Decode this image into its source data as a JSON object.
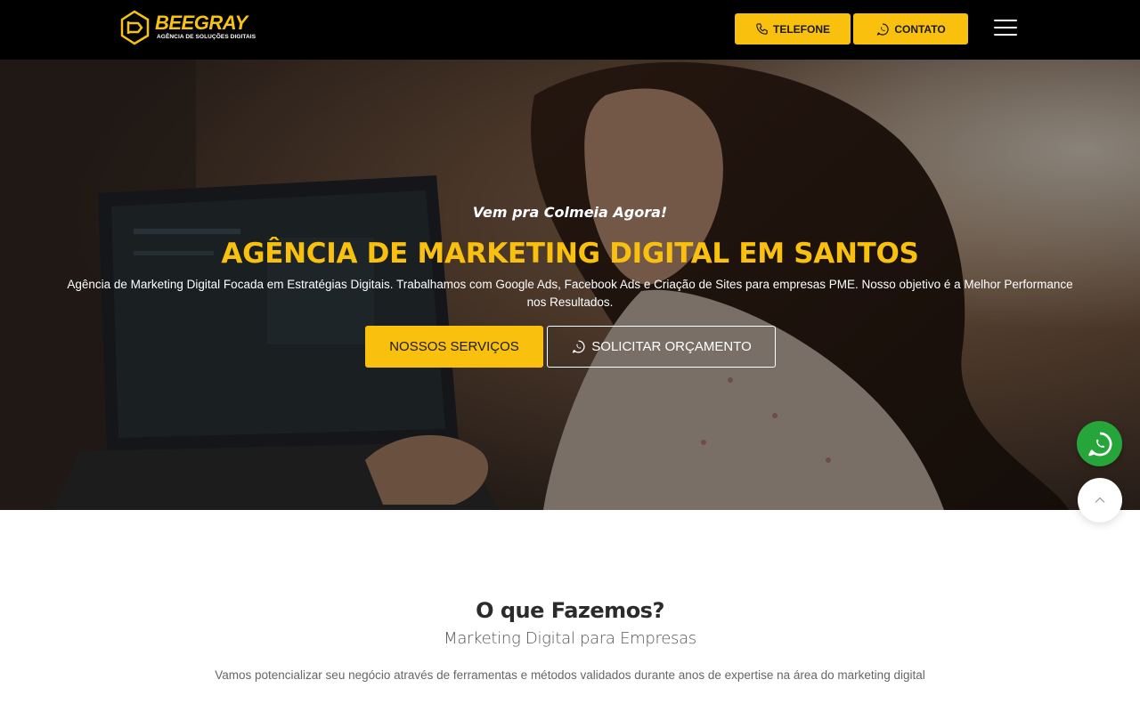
{
  "header": {
    "logo": {
      "wordmark": "BEEGRAY",
      "tagline": "AGÊNCIA DE SOLUÇÕES DIGITAIS"
    },
    "buttons": {
      "telefone": "TELEFONE",
      "contato": "CONTATO"
    },
    "menu_icon": "hamburger-menu-icon"
  },
  "hero": {
    "kicker": "Vem pra Colmeia Agora!",
    "title": "AGÊNCIA DE MARKETING DIGITAL EM SANTOS",
    "description": "Agência de Marketing Digital Focada em Estratégias Digitais. Trabalhamos com Google Ads, Facebook Ads e Criação de Sites para empresas PME. Nosso objetivo é a Melhor Performance nos Resultados.",
    "primary_button": "NOSSOS SERVIÇOS",
    "secondary_button": "SOLICITAR ORÇAMENTO"
  },
  "floating": {
    "whatsapp_icon": "whatsapp-icon",
    "back_to_top_icon": "chevron-up-icon"
  },
  "section": {
    "title": "O que Fazemos?",
    "subtitle": "Marketing Digital para Empresas",
    "text": "Vamos potencializar seu negócio através de ferramentas e métodos validados durante anos de expertise na área do marketing digital"
  },
  "colors": {
    "accent": "#f9c00d",
    "header_bg": "#000000",
    "whatsapp_green": "#25a53a",
    "body_bg": "#ffffff"
  }
}
